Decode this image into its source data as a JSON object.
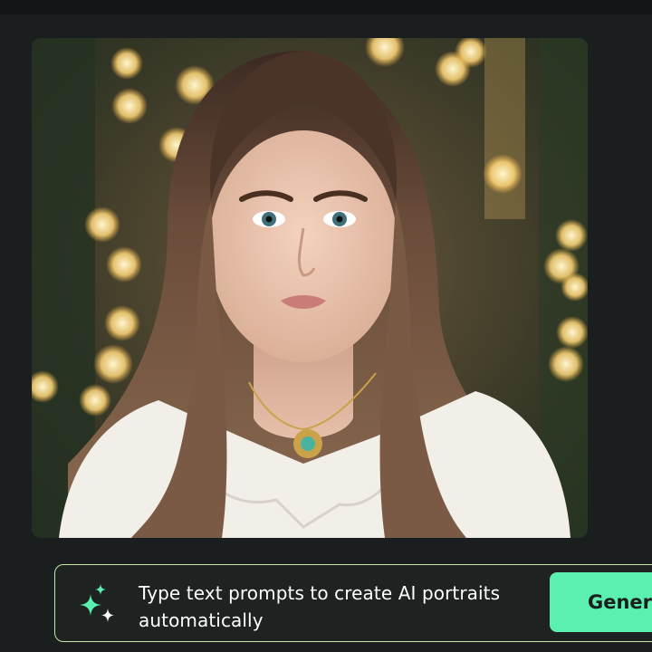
{
  "prompt_bar": {
    "text": "Type text prompts to create AI portraits automatically",
    "button_label": "Generate"
  },
  "colors": {
    "background": "#1b1e1f",
    "accent": "#5cf0b0",
    "prompt_border": "#c4e6a7"
  },
  "icons": {
    "sparkle": "sparkle-icon"
  }
}
